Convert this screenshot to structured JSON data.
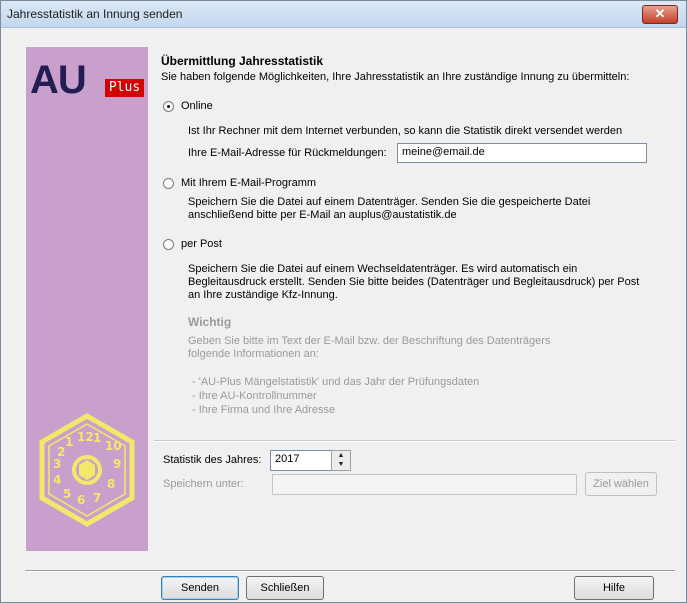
{
  "window": {
    "title": "Jahresstatistik an Innung senden",
    "close_glyph": "✕"
  },
  "sidebar": {
    "logo_text": "AU",
    "logo_badge": "Plus",
    "seal_icon": "pruefplakette-seal",
    "accent": "#c9a0cc"
  },
  "heading": "Übermittlung Jahresstatistik",
  "intro": "Sie haben folgende Möglichkeiten, Ihre Jahresstatistik an Ihre zuständige Innung zu übermitteln:",
  "options": {
    "online": {
      "label": "Online",
      "selected": true,
      "desc": "Ist Ihr Rechner mit dem Internet verbunden, so kann die Statistik direkt versendet werden",
      "email_label": "Ihre E-Mail-Adresse für Rückmeldungen:",
      "email_value": "meine@email.de"
    },
    "mail": {
      "label": "Mit Ihrem E-Mail-Programm",
      "selected": false,
      "desc1": "Speichern Sie die Datei auf einem Datenträger. Senden Sie die  gespeicherte Datei",
      "desc2": "anschließend bitte per E-Mail an auplus@austatistik.de"
    },
    "post": {
      "label": "per Post",
      "selected": false,
      "desc1": "Speichern Sie die Datei auf einem Wechseldatenträger. Es wird  automatisch ein",
      "desc2": "Begleitausdruck erstellt. Senden Sie bitte beides (Datenträger und Begleitausdruck) per Post",
      "desc3": "an Ihre zuständige Kfz-Innung."
    }
  },
  "important": {
    "title": "Wichtig",
    "line1": "Geben Sie bitte im Text der E-Mail bzw. der Beschriftung des Datenträgers",
    "line2": "folgende Informationen an:",
    "items": [
      "- 'AU-Plus Mängelstatistik' und das Jahr der Prüfungsdaten",
      "- Ihre AU-Kontrollnummer",
      "- Ihre Firma und Ihre Adresse"
    ]
  },
  "year": {
    "label": "Statistik des Jahres:",
    "value": "2017"
  },
  "save": {
    "label": "Speichern unter:",
    "value": "",
    "button": "Ziel wählen"
  },
  "buttons": {
    "send": "Senden",
    "close": "Schließen",
    "help": "Hilfe"
  }
}
